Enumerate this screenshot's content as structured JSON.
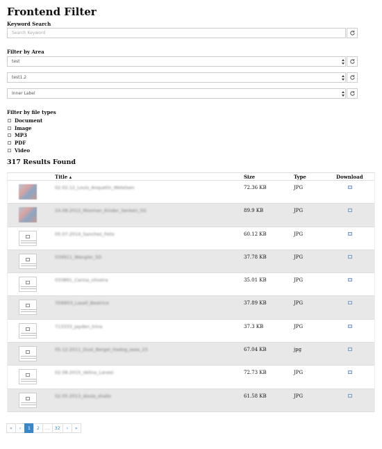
{
  "page": {
    "title": "Frontend Filter"
  },
  "keyword": {
    "label": "Keyword Search",
    "placeholder": "Search Keyword"
  },
  "area": {
    "label": "Filter by Area",
    "selects": [
      {
        "value": "test"
      },
      {
        "value": "test1.2"
      },
      {
        "value": "Inner Label"
      }
    ]
  },
  "filetypes": {
    "label": "Filter by file types",
    "options": [
      "Document",
      "Image",
      "MP3",
      "PDF",
      "Video"
    ]
  },
  "results": {
    "count_text": "317 Results Found",
    "columns": {
      "title": "Title ▴",
      "size": "Size",
      "type": "Type",
      "download": "Download"
    },
    "rows": [
      {
        "thumb": "photo",
        "title": "02.02.12_Louis_Anquetin_Wetelsen",
        "size": "72.36 KB",
        "type": "JPG"
      },
      {
        "thumb": "photo",
        "title": "24.08.2012_Mosman_Kinder_Senken_5G",
        "size": "89.9 KB",
        "type": "JPG"
      },
      {
        "thumb": "placeholder",
        "title": "05.07.2014_Sanchez_Felix",
        "size": "60.12 KB",
        "type": "JPG"
      },
      {
        "thumb": "placeholder",
        "title": "034911_Wangler_5D",
        "size": "37.78 KB",
        "type": "JPG"
      },
      {
        "thumb": "placeholder",
        "title": "033891_Carina_oliveira",
        "size": "35.01 KB",
        "type": "JPG"
      },
      {
        "thumb": "placeholder",
        "title": "7D9953_Lasall_Beatrice",
        "size": "37.89 KB",
        "type": "JPG"
      },
      {
        "thumb": "placeholder",
        "title": "713333_jayden_trina",
        "size": "37.3 KB",
        "type": "JPG"
      },
      {
        "thumb": "placeholder",
        "title": "05.12.2011_Dust_Bergel_Hadog_seas_23",
        "size": "67.04 KB",
        "type": "jpg"
      },
      {
        "thumb": "placeholder",
        "title": "02.08.2015_Velina_Lanesi",
        "size": "72.73 KB",
        "type": "JPG"
      },
      {
        "thumb": "placeholder",
        "title": "02.05.2013_doula_shallo",
        "size": "61.58 KB",
        "type": "JPG"
      }
    ]
  },
  "pagination": {
    "items": [
      {
        "label": "«",
        "active": false
      },
      {
        "label": "‹",
        "active": false
      },
      {
        "label": "1",
        "active": true
      },
      {
        "label": "2",
        "active": false
      },
      {
        "label": "…",
        "active": false,
        "ellipsis": true
      },
      {
        "label": "32",
        "active": false
      },
      {
        "label": "›",
        "active": false
      },
      {
        "label": "»",
        "active": false
      }
    ]
  },
  "icons": {
    "reset": "refresh-icon",
    "download": "image-download-icon",
    "select": "select-arrows-icon"
  },
  "colors": {
    "accent": "#3a87c8",
    "row_alt": "#e8e8e8"
  }
}
